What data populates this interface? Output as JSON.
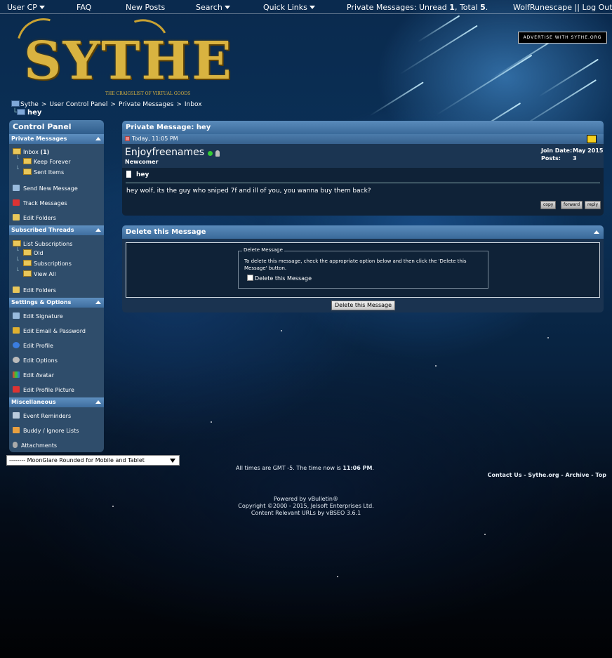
{
  "topnav": {
    "user_cp": "User CP",
    "faq": "FAQ",
    "new_posts": "New Posts",
    "search": "Search",
    "quick_links": "Quick Links",
    "pm_prefix": "Private Messages: Unread ",
    "pm_unread": "1",
    "pm_middle": ", Total ",
    "pm_total": "5",
    "pm_suffix": ".",
    "username": "WolfRunescape",
    "separator": "||",
    "logout": "Log Out"
  },
  "logo": {
    "text": "SYTHE",
    "tagline": "THE CRAIGSLIST OF VIRTUAL GOODS"
  },
  "advert": "ADVERTISE WITH SYTHE.ORG",
  "breadcrumb": {
    "items": [
      "Sythe",
      ">",
      "User Control Panel",
      ">",
      "Private Messages",
      ">",
      "Inbox"
    ],
    "current": "hey"
  },
  "sidebar": {
    "title": "Control Panel",
    "sections": {
      "pm": "Private Messages",
      "subs": "Subscribed Threads",
      "settings": "Settings & Options",
      "misc": "Miscellaneous"
    },
    "items": {
      "inbox": "Inbox",
      "inbox_count": "(1)",
      "keep_forever": "Keep Forever",
      "sent_items": "Sent Items",
      "send_new": "Send New Message",
      "track": "Track Messages",
      "edit_folders_pm": "Edit Folders",
      "list_subs": "List Subscriptions",
      "old": "Old",
      "subscriptions": "Subscriptions",
      "view_all": "View All",
      "edit_folders_subs": "Edit Folders",
      "edit_signature": "Edit Signature",
      "edit_email": "Edit Email & Password",
      "edit_profile": "Edit Profile",
      "edit_options": "Edit Options",
      "edit_avatar": "Edit Avatar",
      "edit_profile_picture": "Edit Profile Picture",
      "event_reminders": "Event Reminders",
      "buddy_ignore": "Buddy / Ignore Lists",
      "attachments": "Attachments"
    }
  },
  "message": {
    "header_label": "Private Message:",
    "header_title": "hey",
    "date": "Today, 11:05 PM",
    "username": "Enjoyfreenames",
    "user_title": "Newcomer",
    "join_label": "Join Date:",
    "join_value": "May 2015",
    "posts_label": "Posts:",
    "posts_value": "3",
    "subject": "hey",
    "body": "hey wolf, its the guy who sniped 7f and ill of you, you wanna buy them back?",
    "buttons": {
      "copy": "copy",
      "forward": "forward",
      "reply": "reply"
    }
  },
  "delete": {
    "title": "Delete this Message",
    "legend": "Delete Message",
    "instructions": "To delete this message, check the appropriate option below and then click the 'Delete this Message' button.",
    "checkbox_label": "Delete this Message",
    "button": "Delete this Message"
  },
  "style_select": "-------- MoonGlare Rounded for Mobile and Tablet",
  "footer": {
    "time_prefix": "All times are GMT -5. The time now is ",
    "time_value": "11:06 PM",
    "time_suffix": ".",
    "links": {
      "contact": "Contact Us",
      "sythe": "Sythe.org",
      "archive": "Archive",
      "top": "Top",
      "dash": "-"
    },
    "powered": "Powered by vBulletin®",
    "copyright": "Copyright ©2000 - 2015, Jelsoft Enterprises Ltd.",
    "vbseo": "Content Relevant URLs by vBSEO 3.6.1"
  },
  "colors": {
    "panel_header": "#4a7bab",
    "panel_body": "#1a3350",
    "logo_gold": "#d9b340"
  }
}
